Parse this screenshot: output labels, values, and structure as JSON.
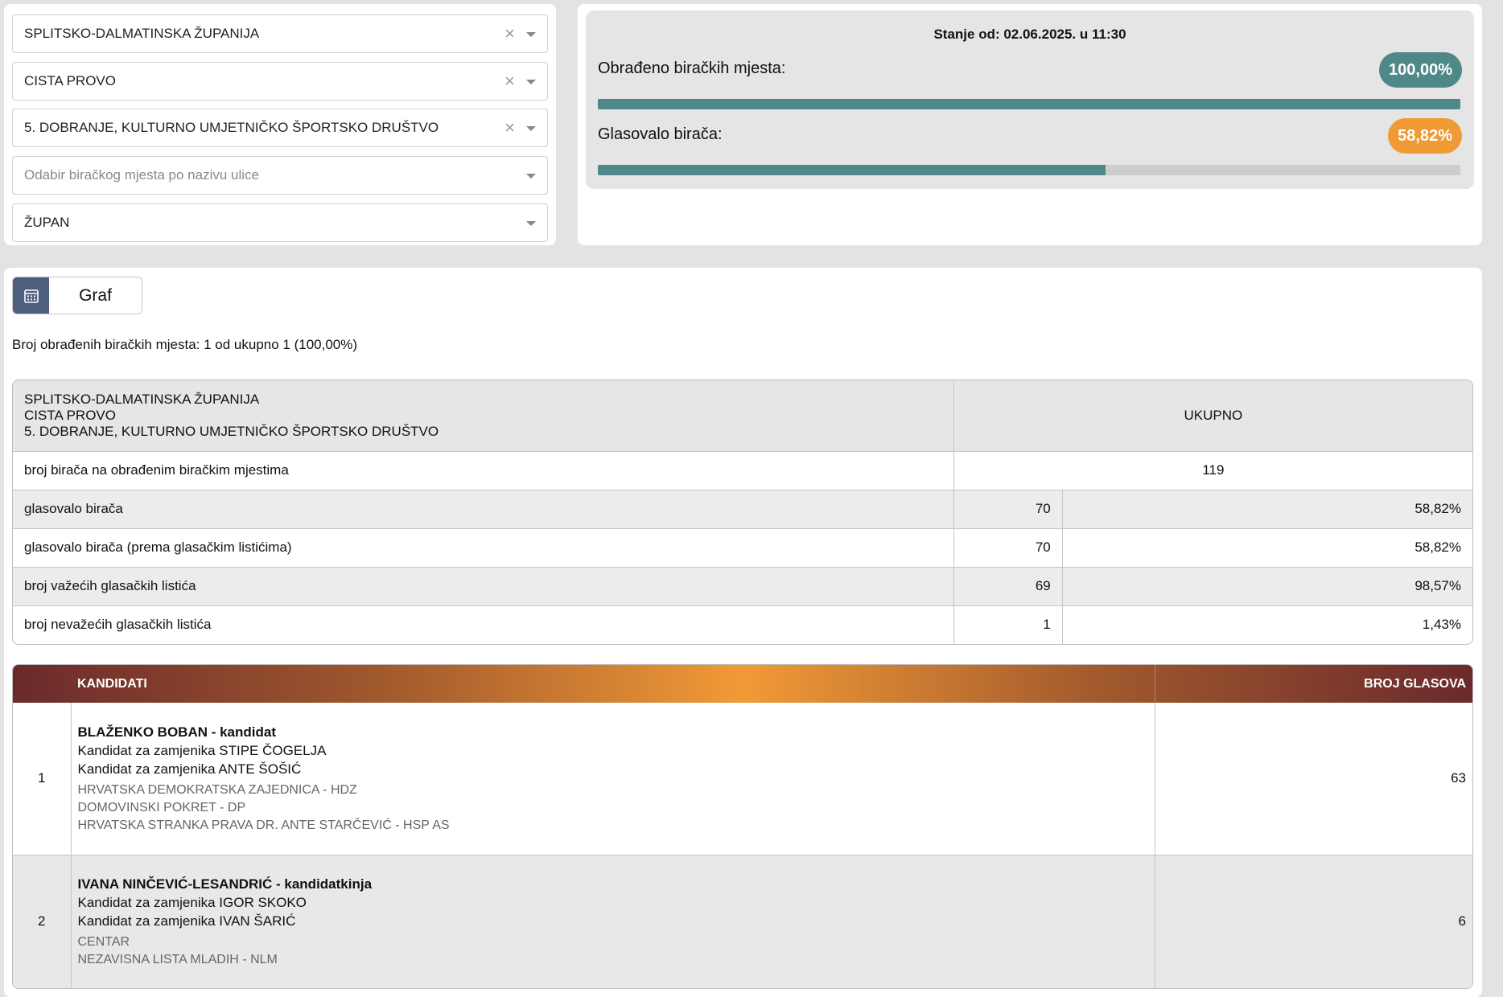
{
  "filters": {
    "county": "SPLITSKO-DALMATINSKA ŽUPANIJA",
    "city": "CISTA PROVO",
    "polling_station": "5. DOBRANJE, KULTURNO UMJETNIČKO ŠPORTSKO DRUŠTVO",
    "street_placeholder": "Odabir biračkog mjesta po nazivu ulice",
    "election_type": "ŽUPAN",
    "clear_glyph": "×"
  },
  "status": {
    "date_text": "Stanje od: 02.06.2025. u 11:30",
    "processed_label": "Obrađeno biračkih mjesta:",
    "processed_value": "100,00%",
    "processed_fraction": 1.0,
    "turnout_label": "Glasovalo birača:",
    "turnout_value": "58,82%",
    "turnout_fraction": 0.5882
  },
  "main": {
    "graf_label": "Graf",
    "graf_icon": "calendar-grid-icon",
    "processed_text": "Broj obrađenih biračkih mjesta: 1 od ukupno 1 (100,00%)"
  },
  "summary": {
    "location_lines": [
      "SPLITSKO-DALMATINSKA ŽUPANIJA",
      "CISTA PROVO",
      "5. DOBRANJE, KULTURNO UMJETNIČKO ŠPORTSKO DRUŠTVO"
    ],
    "total_header": "UKUPNO",
    "voters_label": "broj birača na obrađenim biračkim mjestima",
    "voters_value": "119",
    "rows": [
      {
        "label": "glasovalo birača",
        "count": "70",
        "pct": "58,82%"
      },
      {
        "label": "glasovalo birača (prema glasačkim listićima)",
        "count": "70",
        "pct": "58,82%"
      },
      {
        "label": "broj važećih glasačkih listića",
        "count": "69",
        "pct": "98,57%"
      },
      {
        "label": "broj nevažećih glasačkih listića",
        "count": "1",
        "pct": "1,43%"
      }
    ]
  },
  "candidates": {
    "header_candidates": "KANDIDATI",
    "header_votes": "BROJ GLASOVA",
    "items": [
      {
        "index": "1",
        "name": "BLAŽENKO BOBAN - kandidat",
        "deputy1": "Kandidat za zamjenika STIPE ČOGELJA",
        "deputy2": "Kandidat za zamjenika ANTE ŠOŠIĆ",
        "parties": [
          "HRVATSKA DEMOKRATSKA ZAJEDNICA - HDZ",
          "DOMOVINSKI POKRET - DP",
          "HRVATSKA STRANKA PRAVA DR. ANTE STARČEVIĆ - HSP AS"
        ],
        "votes": "63"
      },
      {
        "index": "2",
        "name": "IVANA NINČEVIĆ-LESANDRIĆ - kandidatkinja",
        "deputy1": "Kandidat za zamjenika IGOR SKOKO",
        "deputy2": "Kandidat za zamjenika IVAN ŠARIĆ",
        "parties": [
          "CENTAR",
          "NEZAVISNA LISTA MLADIH - NLM"
        ],
        "votes": "6"
      }
    ]
  },
  "colors": {
    "teal": "#4f8987",
    "orange": "#ef9a35",
    "graf_icon_bg": "#4f5d7e",
    "header_gradient_dark": "#6a2a2c",
    "header_gradient_light": "#f19a37"
  }
}
